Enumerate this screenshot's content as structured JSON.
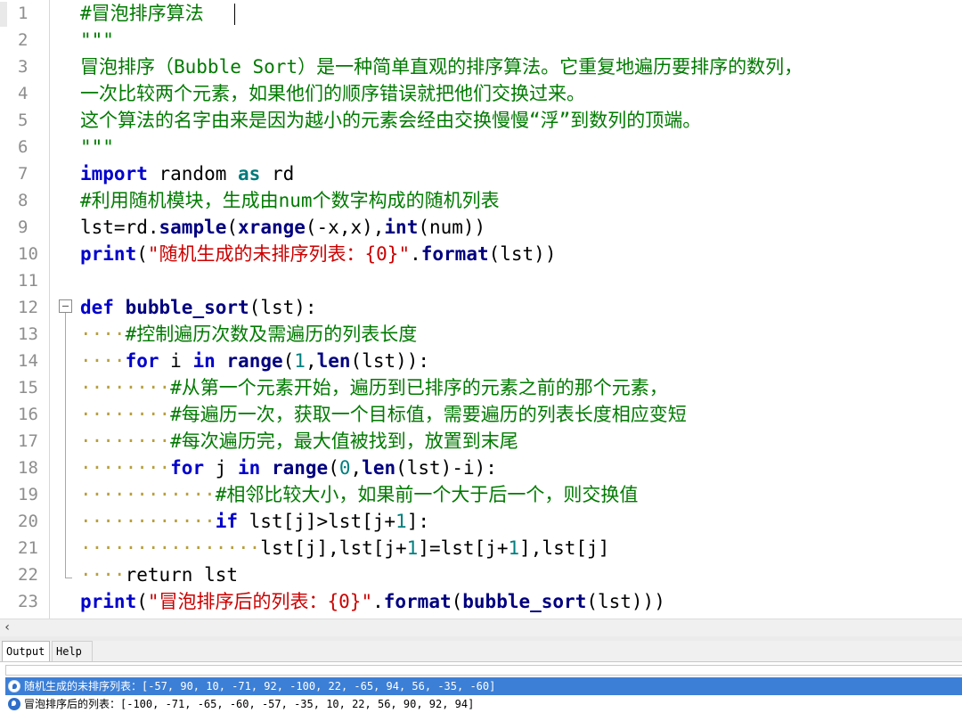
{
  "editor": {
    "line_numbers": [
      "1",
      "2",
      "3",
      "4",
      "5",
      "6",
      "7",
      "8",
      "9",
      "10",
      "11",
      "12",
      "13",
      "14",
      "15",
      "16",
      "17",
      "18",
      "19",
      "20",
      "21",
      "22",
      "23"
    ],
    "code": {
      "l1": "#冒泡排序算法",
      "l2": "\"\"\"",
      "l3": "冒泡排序（Bubble Sort）是一种简单直观的排序算法。它重复地遍历要排序的数列，",
      "l4": "一次比较两个元素，如果他们的顺序错误就把他们交换过来。",
      "l5": "这个算法的名字由来是因为越小的元素会经由交换慢慢“浮”到数列的顶端。",
      "l6": "\"\"\"",
      "l7_kw": "import",
      "l7_mid": " random ",
      "l7_as": "as",
      "l7_end": " rd",
      "l8": "#利用随机模块，生成由num个数字构成的随机列表",
      "l9_a": "lst=rd.",
      "l9_b": "sample",
      "l9_c": "(",
      "l9_d": "xrange",
      "l9_e": "(-x,x),",
      "l9_f": "int",
      "l9_g": "(num))",
      "l10_a": "print",
      "l10_b": "(",
      "l10_c": "\"随机生成的未排序列表：{0}\"",
      "l10_d": ".",
      "l10_e": "format",
      "l10_f": "(lst))",
      "l12_a": "def",
      "l12_b": " ",
      "l12_c": "bubble_sort",
      "l12_d": "(lst):",
      "l13_ws": "····",
      "l13": "#控制遍历次数及需遍历的列表长度",
      "l14_ws": "····",
      "l14_a": "for",
      "l14_b": " i ",
      "l14_c": "in",
      "l14_d": " ",
      "l14_e": "range",
      "l14_f": "(",
      "l14_g": "1",
      "l14_h": ",",
      "l14_i": "len",
      "l14_j": "(lst)):",
      "l15_ws": "········",
      "l15": "#从第一个元素开始，遍历到已排序的元素之前的那个元素，",
      "l16_ws": "········",
      "l16": "#每遍历一次，获取一个目标值，需要遍历的列表长度相应变短",
      "l17_ws": "········",
      "l17": "#每次遍历完，最大值被找到，放置到末尾",
      "l18_ws": "········",
      "l18_a": "for",
      "l18_b": " j ",
      "l18_c": "in",
      "l18_d": " ",
      "l18_e": "range",
      "l18_f": "(",
      "l18_g": "0",
      "l18_h": ",",
      "l18_i": "len",
      "l18_j": "(lst)-i):",
      "l19_ws": "············",
      "l19": "#相邻比较大小，如果前一个大于后一个，则交换值",
      "l20_ws": "············",
      "l20_a": "if",
      "l20_b": " lst[j]>lst[j+",
      "l20_c": "1",
      "l20_d": "]:",
      "l21_ws": "················",
      "l21_a": "lst[j],lst[j+",
      "l21_b": "1",
      "l21_c": "]=lst[j+",
      "l21_d": "1",
      "l21_e": "],lst[j]",
      "l22_ws": "····",
      "l22": "return lst",
      "l23_a": "print",
      "l23_b": "(",
      "l23_c": "\"冒泡排序后的列表：{0}\"",
      "l23_d": ".",
      "l23_e": "format",
      "l23_f": "(",
      "l23_g": "bubble_sort",
      "l23_h": "(lst)))"
    }
  },
  "tabs": {
    "output": "Output",
    "help": "Help"
  },
  "output": {
    "row1": "随机生成的未排序列表：[-57, 90, 10, -71, 92, -100, 22, -65, 94, 56, -35, -60]",
    "row2": "冒泡排序后的列表：[-100, -71, -65, -60, -57, -35, 10, 22, 56, 90, 92, 94]"
  },
  "colors": {
    "comment": "#007a00",
    "keyword": "#0000cc",
    "string": "#cc0000",
    "number": "#007f7f",
    "selection": "#3c7fd6"
  },
  "icons": {
    "scroll_left": "chevron-left-icon",
    "output_row": "python-run-icon",
    "fold": "fold-minus-icon"
  }
}
